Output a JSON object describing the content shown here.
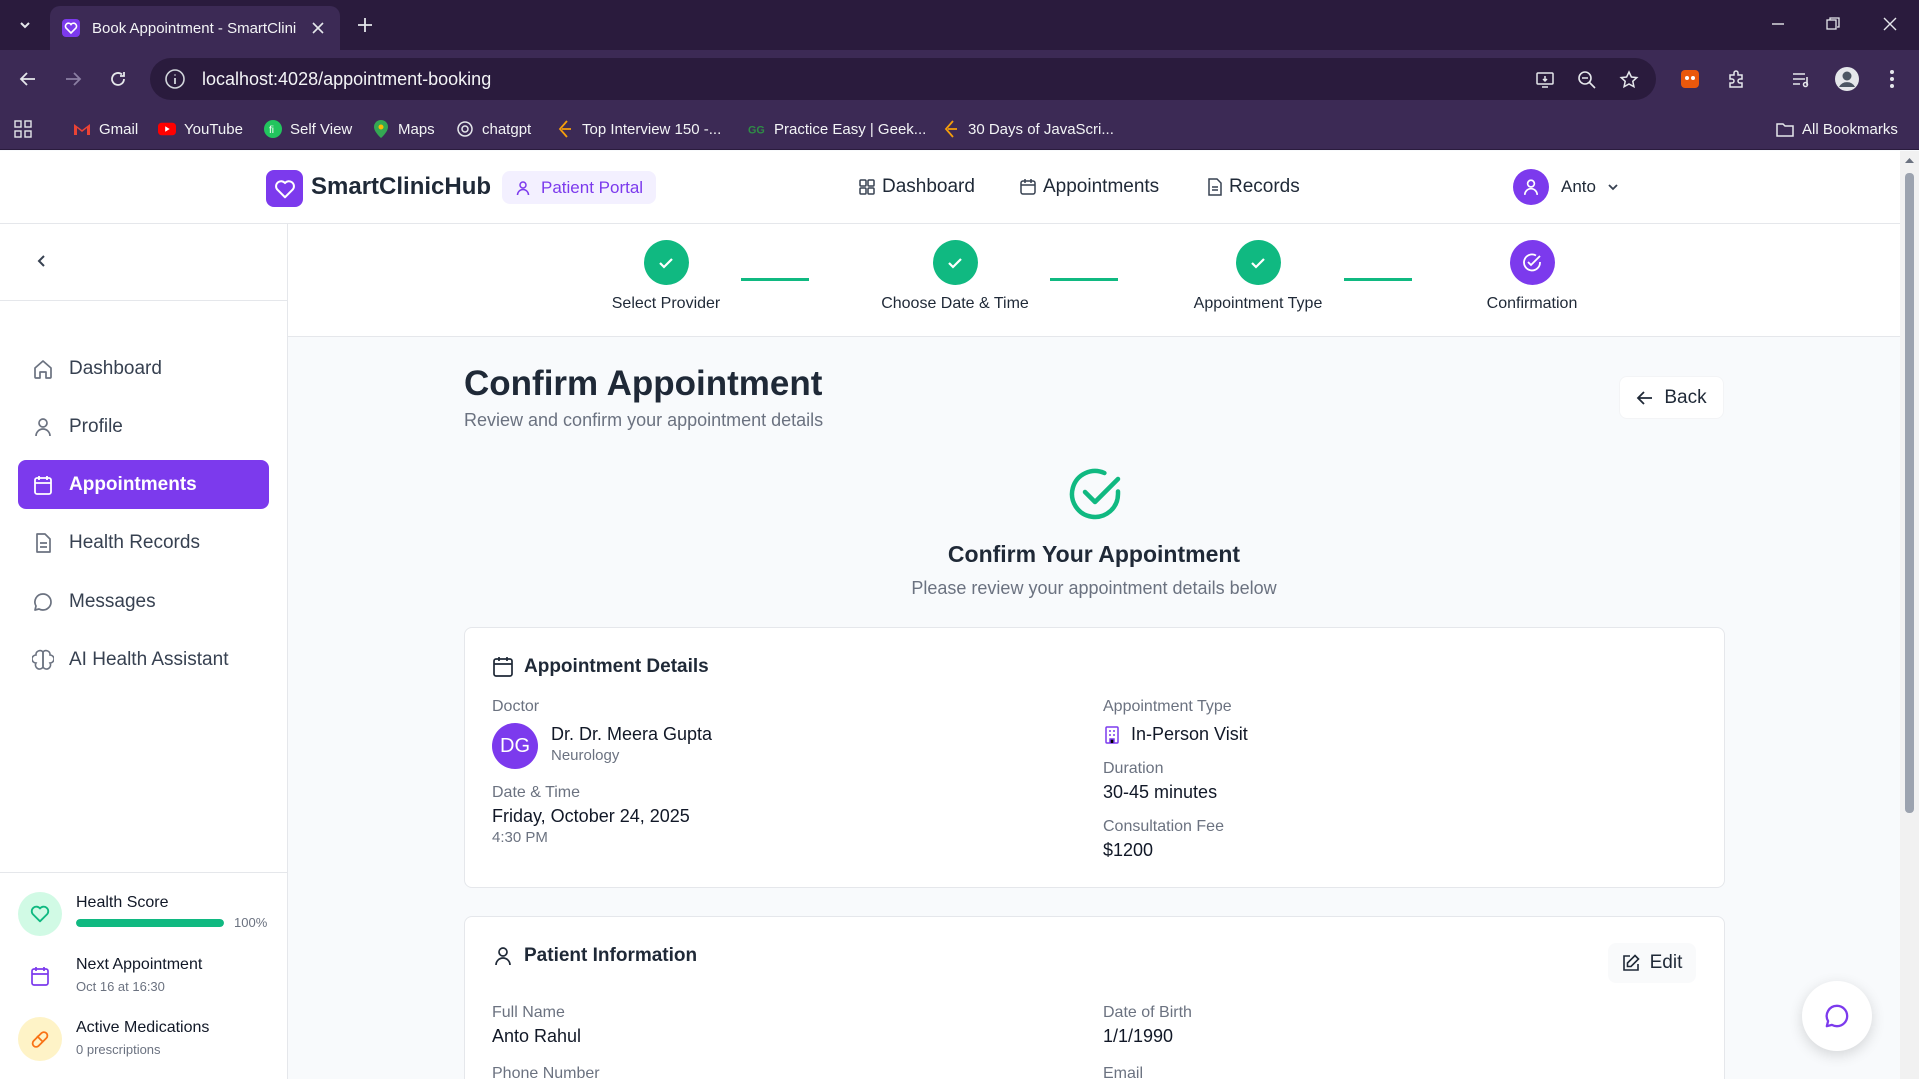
{
  "browser": {
    "tab_title": "Book Appointment - SmartClini",
    "url": "localhost:4028/appointment-booking",
    "bookmarks": [
      {
        "label": "Gmail",
        "icon": "gmail-icon"
      },
      {
        "label": "YouTube",
        "icon": "youtube-icon"
      },
      {
        "label": "Self View",
        "icon": "selfview-icon"
      },
      {
        "label": "Maps",
        "icon": "maps-icon"
      },
      {
        "label": "chatgpt",
        "icon": "chatgpt-icon"
      },
      {
        "label": "Top Interview 150 -...",
        "icon": "leetcode-icon"
      },
      {
        "label": "Practice Easy | Geek...",
        "icon": "gfg-icon"
      },
      {
        "label": "30 Days of JavaScri...",
        "icon": "leetcode-icon"
      }
    ],
    "all_bookmarks": "All Bookmarks"
  },
  "header": {
    "brand": "SmartClinicHub",
    "portal_badge": "Patient Portal",
    "nav": {
      "dashboard": "Dashboard",
      "appointments": "Appointments",
      "records": "Records"
    },
    "user_name": "Anto"
  },
  "sidebar": {
    "items": [
      {
        "label": "Dashboard",
        "icon": "home-icon",
        "active": false
      },
      {
        "label": "Profile",
        "icon": "user-icon",
        "active": false
      },
      {
        "label": "Appointments",
        "icon": "calendar-icon",
        "active": true
      },
      {
        "label": "Health Records",
        "icon": "file-icon",
        "active": false
      },
      {
        "label": "Messages",
        "icon": "message-icon",
        "active": false
      },
      {
        "label": "AI Health Assistant",
        "icon": "brain-icon",
        "active": false
      }
    ],
    "health_score": {
      "title": "Health Score",
      "percent_label": "100%",
      "value": 1.0
    },
    "next_appointment": {
      "title": "Next Appointment",
      "sub": "Oct 16 at 16:30"
    },
    "active_medications": {
      "title": "Active Medications",
      "sub": "0 prescriptions"
    }
  },
  "stepper": {
    "steps": [
      {
        "label": "Select Provider",
        "state": "done"
      },
      {
        "label": "Choose Date & Time",
        "state": "done"
      },
      {
        "label": "Appointment Type",
        "state": "done"
      },
      {
        "label": "Confirmation",
        "state": "current"
      }
    ]
  },
  "main": {
    "title": "Confirm Appointment",
    "subtitle": "Review and confirm your appointment details",
    "back_label": "Back",
    "confirm_title": "Confirm Your Appointment",
    "confirm_sub": "Please review your appointment details below"
  },
  "appointment_details": {
    "heading": "Appointment Details",
    "doctor_label": "Doctor",
    "doctor_initials": "DG",
    "doctor_name": "Dr. Dr. Meera Gupta",
    "doctor_specialty": "Neurology",
    "datetime_label": "Date & Time",
    "date": "Friday, October 24, 2025",
    "time": "4:30 PM",
    "type_label": "Appointment Type",
    "type_value": "In-Person Visit",
    "duration_label": "Duration",
    "duration_value": "30-45 minutes",
    "fee_label": "Consultation Fee",
    "fee_value": "$1200"
  },
  "patient_info": {
    "heading": "Patient Information",
    "edit_label": "Edit",
    "full_name_label": "Full Name",
    "full_name": "Anto Rahul",
    "dob_label": "Date of Birth",
    "dob": "1/1/1990",
    "phone_label": "Phone Number",
    "email_label": "Email"
  },
  "colors": {
    "accent": "#7c3aed",
    "success": "#10b981",
    "chrome": "#3c2a55"
  }
}
